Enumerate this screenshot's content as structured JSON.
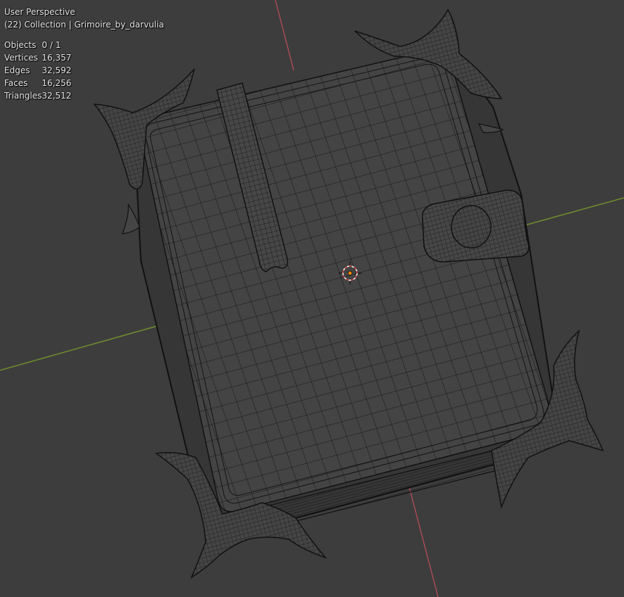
{
  "viewport": {
    "view_name": "User Perspective",
    "collection_line": "(22) Collection | Grimoire_by_darvulia",
    "stats": [
      {
        "label": "Objects",
        "value": "0 / 1"
      },
      {
        "label": "Vertices",
        "value": "16,357"
      },
      {
        "label": "Edges",
        "value": "32,592"
      },
      {
        "label": "Faces",
        "value": "16,256"
      },
      {
        "label": "Triangles",
        "value": "32,512"
      }
    ]
  },
  "colors": {
    "background": "#3d3d3d",
    "x_axis": "#a84a54",
    "y_axis": "#6f8f2e",
    "wire": "#111111",
    "mesh_face": "#444444",
    "origin": "#ff8c00"
  }
}
